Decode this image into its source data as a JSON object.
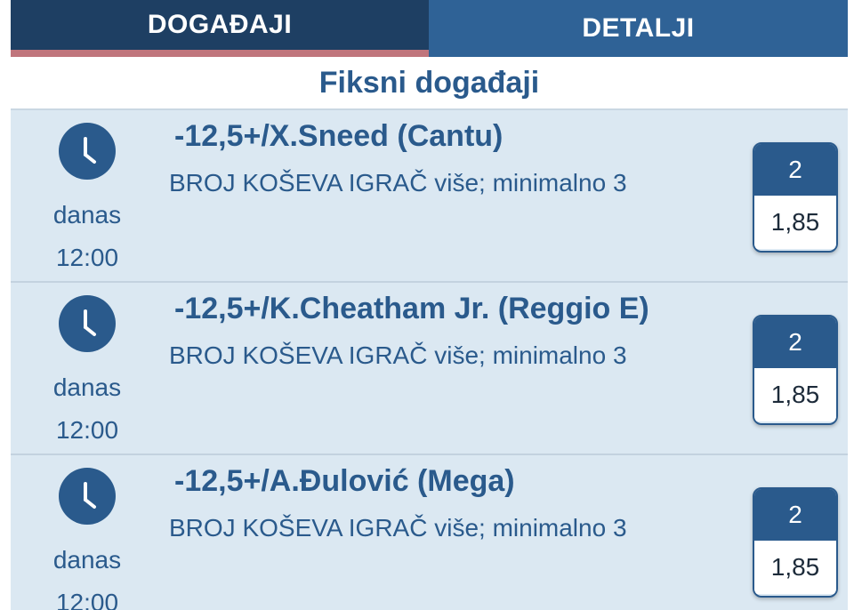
{
  "tabs": {
    "events": "DOGAĐAJI",
    "details": "DETALJI"
  },
  "section_title": "Fiksni događaji",
  "rows": [
    {
      "day": "danas",
      "time": "12:00",
      "title": "-12,5+/X.Sneed (Cantu)",
      "subtitle": "BROJ KOŠEVA IGRAČ više; minimalno 3",
      "odd_label": "2",
      "odd_value": "1,85"
    },
    {
      "day": "danas",
      "time": "12:00",
      "title": "-12,5+/K.Cheatham Jr. (Reggio E)",
      "subtitle": "BROJ KOŠEVA IGRAČ više; minimalno 3",
      "odd_label": "2",
      "odd_value": "1,85"
    },
    {
      "day": "danas",
      "time": "12:00",
      "title": "-12,5+/A.Đulović (Mega)",
      "subtitle": "BROJ KOŠEVA IGRAČ više; minimalno 3",
      "odd_label": "2",
      "odd_value": "1,85"
    }
  ],
  "colors": {
    "primary": "#2a5a8c",
    "tab_dark": "#1e3f63",
    "tab_accent": "#c0757c",
    "row_bg": "#dbe8f2"
  },
  "icons": {
    "clock": "clock-icon"
  }
}
